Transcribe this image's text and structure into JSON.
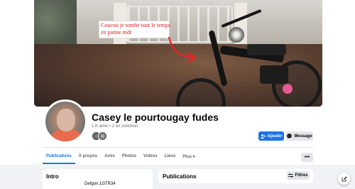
{
  "cover": {
    "caption": "Coucou je tombe tout le temps en panne mdr",
    "caption_color": "#d61a1a"
  },
  "profile": {
    "name": "Casey le pourtougay fudes",
    "meta": "1 K amis • 2 en commun"
  },
  "actions": {
    "add_label": "Ajouter",
    "message_label": "Message",
    "more_label": "•••"
  },
  "tabs": [
    {
      "label": "Publications",
      "active": true
    },
    {
      "label": "À propos"
    },
    {
      "label": "Amis"
    },
    {
      "label": "Photos"
    },
    {
      "label": "Vidéos"
    },
    {
      "label": "Lieux"
    },
    {
      "label": "Plus ▾"
    }
  ],
  "intro": {
    "title": "Intro",
    "line": "Defgon.1GTR34"
  },
  "posts": {
    "title": "Publications",
    "filters_label": "Filtres"
  },
  "colors": {
    "accent": "#1b74e4",
    "secondary_button": "#e4e6eb",
    "page_bg": "#f0f2f5"
  },
  "icons": {
    "add_friend": "add-friend-icon",
    "messenger": "messenger-icon",
    "filters": "filters-icon",
    "compose": "compose-icon"
  }
}
